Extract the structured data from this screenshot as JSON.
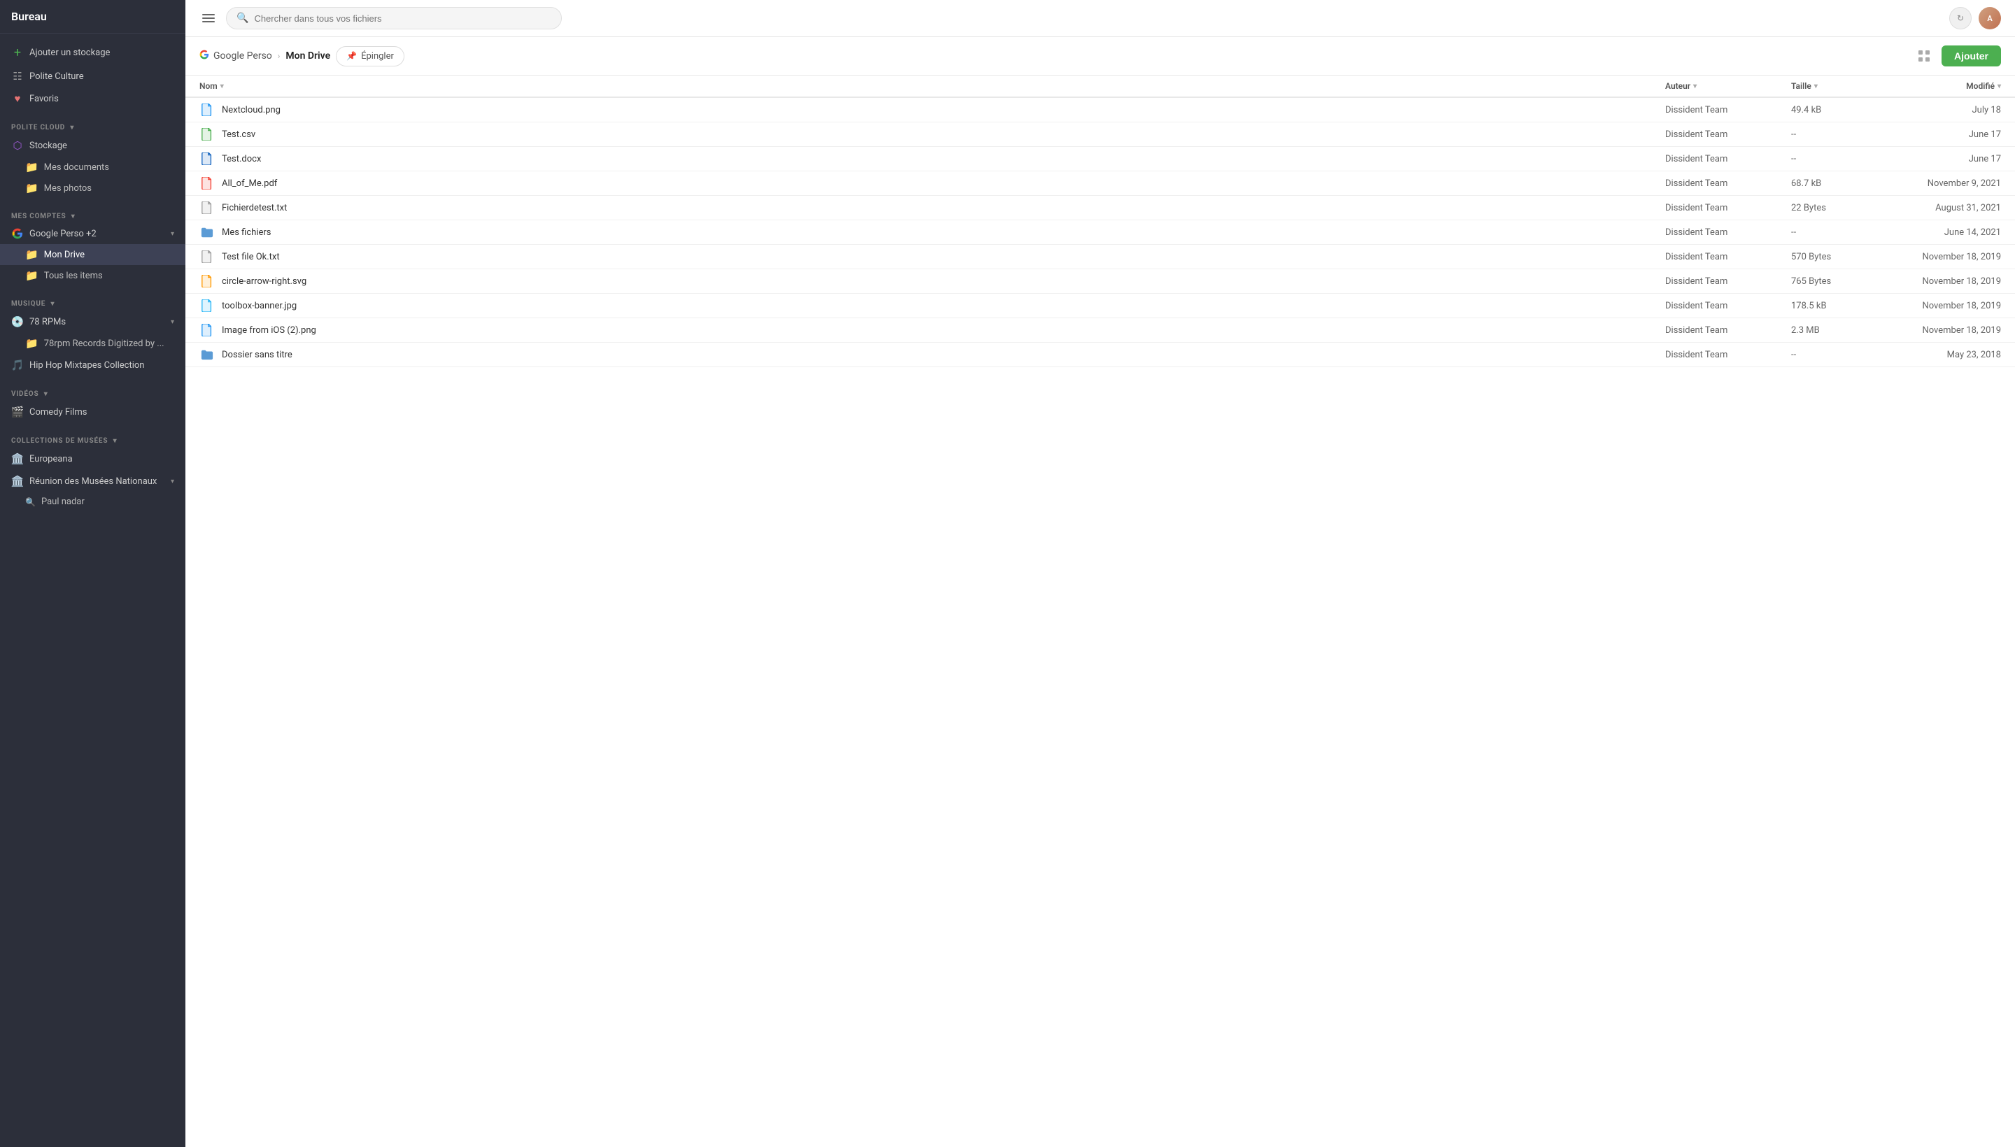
{
  "sidebar": {
    "title": "Bureau",
    "add_storage_label": "Ajouter un stockage",
    "polite_culture_label": "Polite Culture",
    "favoris_label": "Favoris",
    "polite_cloud_section": "POLITE CLOUD",
    "stockage_label": "Stockage",
    "mes_documents_label": "Mes documents",
    "mes_photos_label": "Mes photos",
    "mes_comptes_section": "MES COMPTES",
    "google_perso_label": "Google Perso +2",
    "mon_drive_label": "Mon Drive",
    "tous_les_items_label": "Tous les items",
    "musique_section": "MUSIQUE",
    "rpm78_label": "78 RPMs",
    "rpm78_sub_label": "78rpm Records Digitized by ...",
    "hiphop_label": "Hip Hop Mixtapes Collection",
    "videos_section": "VIDÉOS",
    "comedy_films_label": "Comedy Films",
    "collections_section": "COLLECTIONS DE MUSÉES",
    "europeana_label": "Europeana",
    "reunion_musees_label": "Réunion des Musées Nationaux",
    "paul_nadar_label": "Paul nadar"
  },
  "topbar": {
    "search_placeholder": "Chercher dans tous vos fichiers",
    "refresh_icon": "↻",
    "avatar_initials": "A"
  },
  "breadcrumb": {
    "google_perso": "Google Perso",
    "mon_drive": "Mon Drive",
    "pin_label": "Épingler",
    "add_label": "Ajouter"
  },
  "table": {
    "headers": {
      "nom": "Nom",
      "auteur": "Auteur",
      "taille": "Taille",
      "modifie": "Modifié"
    },
    "rows": [
      {
        "name": "Nextcloud.png",
        "type": "png",
        "author": "Dissident Team",
        "size": "49.4 kB",
        "date": "July 18"
      },
      {
        "name": "Test.csv",
        "type": "csv",
        "author": "Dissident Team",
        "size": "--",
        "date": "June 17"
      },
      {
        "name": "Test.docx",
        "type": "docx",
        "author": "Dissident Team",
        "size": "--",
        "date": "June 17"
      },
      {
        "name": "All_of_Me.pdf",
        "type": "pdf",
        "author": "Dissident Team",
        "size": "68.7 kB",
        "date": "November 9, 2021"
      },
      {
        "name": "Fichierdetest.txt",
        "type": "txt",
        "author": "Dissident Team",
        "size": "22 Bytes",
        "date": "August 31, 2021"
      },
      {
        "name": "Mes fichiers",
        "type": "folder",
        "author": "Dissident Team",
        "size": "--",
        "date": "June 14, 2021"
      },
      {
        "name": "Test file Ok.txt",
        "type": "txt",
        "author": "Dissident Team",
        "size": "570 Bytes",
        "date": "November 18, 2019"
      },
      {
        "name": "circle-arrow-right.svg",
        "type": "svg",
        "author": "Dissident Team",
        "size": "765 Bytes",
        "date": "November 18, 2019"
      },
      {
        "name": "toolbox-banner.jpg",
        "type": "jpg",
        "author": "Dissident Team",
        "size": "178.5 kB",
        "date": "November 18, 2019"
      },
      {
        "name": "Image from iOS (2).png",
        "type": "png",
        "author": "Dissident Team",
        "size": "2.3 MB",
        "date": "November 18, 2019"
      },
      {
        "name": "Dossier sans titre",
        "type": "folder",
        "author": "Dissident Team",
        "size": "--",
        "date": "May 23, 2018"
      }
    ]
  }
}
